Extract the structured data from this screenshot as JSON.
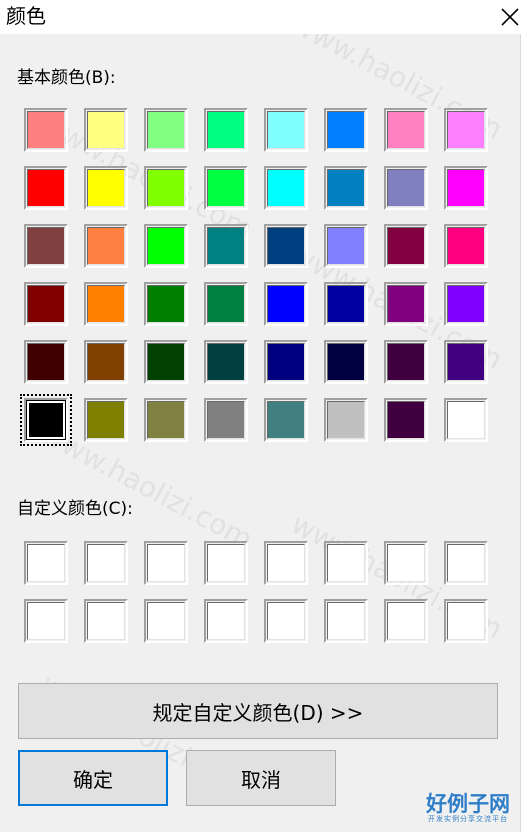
{
  "window": {
    "title": "颜色"
  },
  "basic": {
    "label": "基本颜色(B):",
    "colors": [
      "#ff8080",
      "#ffff80",
      "#80ff80",
      "#00ff80",
      "#80ffff",
      "#0080ff",
      "#ff80c0",
      "#ff80ff",
      "#ff0000",
      "#ffff00",
      "#80ff00",
      "#00ff40",
      "#00ffff",
      "#0080c0",
      "#8080c0",
      "#ff00ff",
      "#804040",
      "#ff8040",
      "#00ff00",
      "#008080",
      "#004080",
      "#8080ff",
      "#800040",
      "#ff0080",
      "#800000",
      "#ff8000",
      "#008000",
      "#008040",
      "#0000ff",
      "#0000a0",
      "#800080",
      "#8000ff",
      "#400000",
      "#804000",
      "#004000",
      "#004040",
      "#000080",
      "#000040",
      "#400040",
      "#400080",
      "#000000",
      "#808000",
      "#808040",
      "#808080",
      "#408080",
      "#c0c0c0",
      "#400040",
      "#ffffff"
    ],
    "selected_index": 40
  },
  "custom": {
    "label": "自定义颜色(C):",
    "colors": [
      "#ffffff",
      "#ffffff",
      "#ffffff",
      "#ffffff",
      "#ffffff",
      "#ffffff",
      "#ffffff",
      "#ffffff",
      "#ffffff",
      "#ffffff",
      "#ffffff",
      "#ffffff",
      "#ffffff",
      "#ffffff",
      "#ffffff",
      "#ffffff"
    ]
  },
  "buttons": {
    "define_custom": "规定自定义颜色(D) >>",
    "ok": "确定",
    "cancel": "取消"
  },
  "watermark": {
    "text": "www.haolizi.com",
    "logo_main": "好例子网",
    "logo_sub": "开发实例分享交流平台"
  },
  "icons": {
    "close": "close-icon"
  }
}
